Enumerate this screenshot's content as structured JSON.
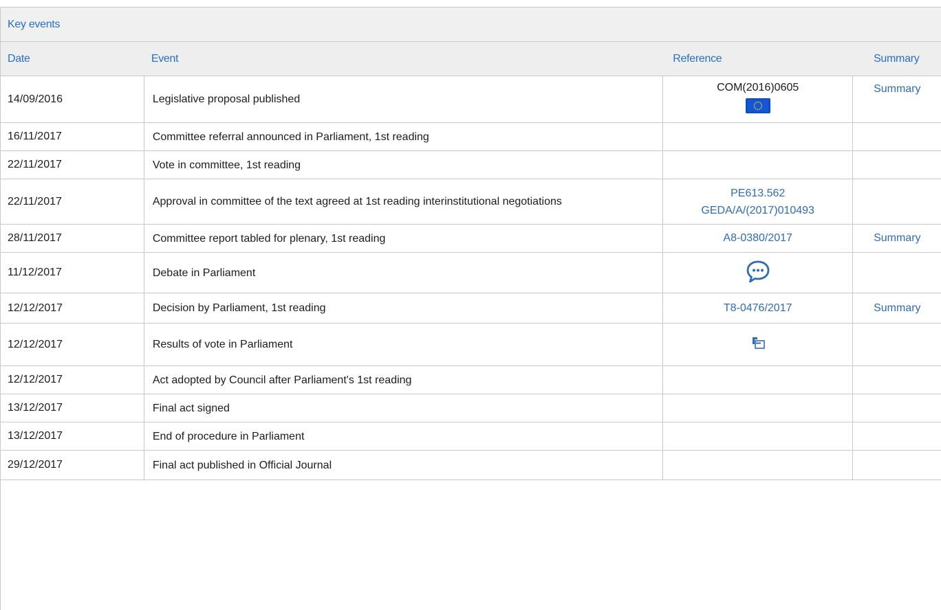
{
  "section_title": "Key events",
  "columns": {
    "date": "Date",
    "event": "Event",
    "reference": "Reference",
    "summary": "Summary"
  },
  "icons": {
    "eu_flag": "eu-flag-icon",
    "debate": "speech-bubble-icon",
    "vote": "vote-ballot-icon"
  },
  "colors": {
    "link": "#2e6cb5",
    "header_text": "#2770c9",
    "eu_blue": "#0a4fc4",
    "eu_star": "#ffcc00"
  },
  "rows": [
    {
      "date": "14/09/2016",
      "event": "Legislative proposal published",
      "reference": "COM(2016)0605",
      "summary": "Summary"
    },
    {
      "date": "16/11/2017",
      "event": "Committee referral announced in Parliament, 1st reading",
      "reference": "",
      "summary": ""
    },
    {
      "date": "22/11/2017",
      "event": "Vote in committee, 1st reading",
      "reference": "",
      "summary": ""
    },
    {
      "date": "22/11/2017",
      "event": "Approval in committee of the text agreed at 1st reading interinstitutional negotiations",
      "reference": "PE613.562",
      "reference2": "GEDA/A/(2017)010493",
      "summary": ""
    },
    {
      "date": "28/11/2017",
      "event": "Committee report tabled for plenary, 1st reading",
      "reference": "A8-0380/2017",
      "summary": "Summary"
    },
    {
      "date": "11/12/2017",
      "event": "Debate in Parliament",
      "reference": "",
      "summary": ""
    },
    {
      "date": "12/12/2017",
      "event": "Decision by Parliament, 1st reading",
      "reference": "T8-0476/2017",
      "summary": "Summary"
    },
    {
      "date": "12/12/2017",
      "event": "Results of vote in Parliament",
      "reference": "",
      "summary": ""
    },
    {
      "date": "12/12/2017",
      "event": "Act adopted by Council after Parliament's 1st reading",
      "reference": "",
      "summary": ""
    },
    {
      "date": "13/12/2017",
      "event": "Final act signed",
      "reference": "",
      "summary": ""
    },
    {
      "date": "13/12/2017",
      "event": "End of procedure in Parliament",
      "reference": "",
      "summary": ""
    },
    {
      "date": "29/12/2017",
      "event": "Final act published in Official Journal",
      "reference": "",
      "summary": ""
    }
  ]
}
